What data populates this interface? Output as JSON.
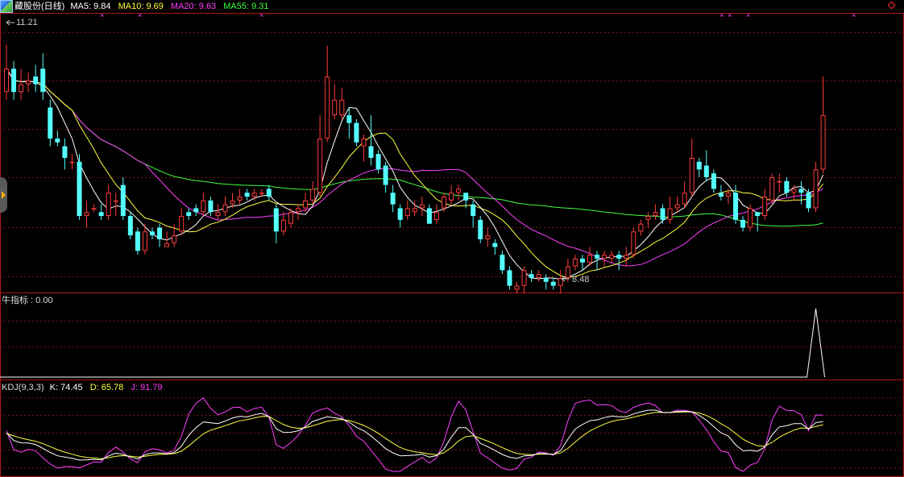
{
  "header": {
    "title": "藏股份(日线)",
    "ma_items": [
      {
        "label": "MA5: 9.84",
        "color": "#ffffff"
      },
      {
        "label": "MA10: 9.69",
        "color": "#ffff40"
      },
      {
        "label": "MA20: 9.63",
        "color": "#ff40ff"
      },
      {
        "label": "MA55: 9.31",
        "color": "#40ff40"
      }
    ]
  },
  "price_panel": {
    "high_label": "11.21",
    "low_label": "8.48",
    "ylim": [
      8.2,
      11.6
    ]
  },
  "indicator_panel": {
    "label": "牛指标 : 0.00"
  },
  "kdj_panel": {
    "label": "KDJ(9,3,3)",
    "values": [
      {
        "label": "K: 74.45",
        "color": "#ffffff"
      },
      {
        "label": "D: 65.78",
        "color": "#ffff40"
      },
      {
        "label": "J: 91.79",
        "color": "#ff40ff"
      }
    ]
  },
  "colors": {
    "up": "#ff3c3c",
    "down": "#54ffff",
    "grid": "#7a1010",
    "border": "#b01818",
    "ma5": "#ffffff",
    "ma10": "#ffff40",
    "ma20": "#ff40ff",
    "ma55": "#40ff40",
    "marker": "#ff40ff"
  },
  "chart_data": {
    "type": "candlestick",
    "candles": [
      [
        10.6,
        10.9,
        11.21,
        10.5
      ],
      [
        10.9,
        10.6,
        11.0,
        10.5
      ],
      [
        10.6,
        10.7,
        10.9,
        10.5
      ],
      [
        10.7,
        10.75,
        10.85,
        10.6
      ],
      [
        10.8,
        10.7,
        10.95,
        10.6
      ],
      [
        10.9,
        10.6,
        11.1,
        10.5
      ],
      [
        10.4,
        10.0,
        10.5,
        9.9
      ],
      [
        10.0,
        9.95,
        10.1,
        9.9
      ],
      [
        9.9,
        9.75,
        10.0,
        9.6
      ],
      [
        9.7,
        9.7,
        9.8,
        9.6
      ],
      [
        9.7,
        9.0,
        9.8,
        8.95
      ],
      [
        9.0,
        9.05,
        9.2,
        8.85
      ],
      [
        9.1,
        9.1,
        9.15,
        9.05
      ],
      [
        9.05,
        9.0,
        9.15,
        8.95
      ],
      [
        9.0,
        9.3,
        9.4,
        8.95
      ],
      [
        9.2,
        9.2,
        9.3,
        9.0
      ],
      [
        9.4,
        9.0,
        9.5,
        8.95
      ],
      [
        9.0,
        8.75,
        9.05,
        8.7
      ],
      [
        8.8,
        8.55,
        8.85,
        8.5
      ],
      [
        8.55,
        8.8,
        8.9,
        8.5
      ],
      [
        8.8,
        8.75,
        8.85,
        8.7
      ],
      [
        8.85,
        8.7,
        8.9,
        8.6
      ],
      [
        8.6,
        8.65,
        8.8,
        8.6
      ],
      [
        8.65,
        8.75,
        8.9,
        8.6
      ],
      [
        8.8,
        9.0,
        9.1,
        8.75
      ],
      [
        9.05,
        9.0,
        9.1,
        8.95
      ],
      [
        9.1,
        9.05,
        9.15,
        9.0
      ],
      [
        9.05,
        9.2,
        9.3,
        9.0
      ],
      [
        9.2,
        9.05,
        9.25,
        9.0
      ],
      [
        9.0,
        9.05,
        9.15,
        8.95
      ],
      [
        9.05,
        9.15,
        9.25,
        9.0
      ],
      [
        9.15,
        9.2,
        9.3,
        9.1
      ],
      [
        9.2,
        9.25,
        9.35,
        9.15
      ],
      [
        9.3,
        9.25,
        9.35,
        9.2
      ],
      [
        9.25,
        9.3,
        9.35,
        9.2
      ],
      [
        9.3,
        9.3,
        9.35,
        9.25
      ],
      [
        9.35,
        9.25,
        9.4,
        9.2
      ],
      [
        9.1,
        8.8,
        9.15,
        8.65
      ],
      [
        8.8,
        8.95,
        9.05,
        8.75
      ],
      [
        8.9,
        9.05,
        9.1,
        8.85
      ],
      [
        9.05,
        9.1,
        9.15,
        8.95
      ],
      [
        9.1,
        9.2,
        9.3,
        9.05
      ],
      [
        9.2,
        9.35,
        9.45,
        9.15
      ],
      [
        9.3,
        10.0,
        10.3,
        9.25
      ],
      [
        10.0,
        10.8,
        11.2,
        9.95
      ],
      [
        10.3,
        10.5,
        10.7,
        10.25
      ],
      [
        10.3,
        10.5,
        10.65,
        10.25
      ],
      [
        10.3,
        10.2,
        10.4,
        10.0
      ],
      [
        10.2,
        9.95,
        10.25,
        9.9
      ],
      [
        9.9,
        10.0,
        10.05,
        9.7
      ],
      [
        9.9,
        9.75,
        10.3,
        9.65
      ],
      [
        9.8,
        9.6,
        9.85,
        9.55
      ],
      [
        9.65,
        9.4,
        9.7,
        9.3
      ],
      [
        9.3,
        9.15,
        9.4,
        9.05
      ],
      [
        9.1,
        8.95,
        9.15,
        8.85
      ],
      [
        9.0,
        9.1,
        9.2,
        8.95
      ],
      [
        9.05,
        9.1,
        9.2,
        9.0
      ],
      [
        9.1,
        9.15,
        9.25,
        9.0
      ],
      [
        9.1,
        8.9,
        9.15,
        8.9
      ],
      [
        8.95,
        9.05,
        9.15,
        8.9
      ],
      [
        9.1,
        9.25,
        9.3,
        9.05
      ],
      [
        9.2,
        9.3,
        9.4,
        9.15
      ],
      [
        9.3,
        9.35,
        9.4,
        9.2
      ],
      [
        9.3,
        9.2,
        9.3,
        9.1
      ],
      [
        9.15,
        9.0,
        9.2,
        8.85
      ],
      [
        8.95,
        8.7,
        9.0,
        8.65
      ],
      [
        8.7,
        8.75,
        8.85,
        8.6
      ],
      [
        8.65,
        8.6,
        8.7,
        8.5
      ],
      [
        8.5,
        8.3,
        8.55,
        8.25
      ],
      [
        8.3,
        8.1,
        8.35,
        8.05
      ],
      [
        8.05,
        8.1,
        8.15,
        8.0
      ],
      [
        8.1,
        8.3,
        8.35,
        8.0
      ],
      [
        8.25,
        8.2,
        8.3,
        8.15
      ],
      [
        8.2,
        8.25,
        8.3,
        8.15
      ],
      [
        8.2,
        8.15,
        8.25,
        8.05
      ],
      [
        8.15,
        8.1,
        8.2,
        8.05
      ],
      [
        8.1,
        8.2,
        8.3,
        8.0
      ],
      [
        8.2,
        8.35,
        8.45,
        8.15
      ],
      [
        8.35,
        8.45,
        8.5,
        8.3
      ],
      [
        8.45,
        8.4,
        8.5,
        8.3
      ],
      [
        8.4,
        8.5,
        8.6,
        8.35
      ],
      [
        8.5,
        8.45,
        8.55,
        8.3
      ],
      [
        8.45,
        8.5,
        8.55,
        8.35
      ],
      [
        8.45,
        8.5,
        8.55,
        8.4
      ],
      [
        8.5,
        8.45,
        8.55,
        8.3
      ],
      [
        8.45,
        8.5,
        8.6,
        8.35
      ],
      [
        8.5,
        8.8,
        8.85,
        8.45
      ],
      [
        8.8,
        8.9,
        8.95,
        8.75
      ],
      [
        8.95,
        9.0,
        9.05,
        8.85
      ],
      [
        9.0,
        9.05,
        9.15,
        8.95
      ],
      [
        9.1,
        8.95,
        9.15,
        8.9
      ],
      [
        8.95,
        9.1,
        9.25,
        8.9
      ],
      [
        9.1,
        9.15,
        9.25,
        9.05
      ],
      [
        9.15,
        9.3,
        9.45,
        9.1
      ],
      [
        9.3,
        9.75,
        10.0,
        9.25
      ],
      [
        9.7,
        9.6,
        9.75,
        9.5
      ],
      [
        9.65,
        9.5,
        9.85,
        9.45
      ],
      [
        9.55,
        9.35,
        9.6,
        9.3
      ],
      [
        9.3,
        9.25,
        9.4,
        9.2
      ],
      [
        9.25,
        9.3,
        9.35,
        9.15
      ],
      [
        9.3,
        8.95,
        9.4,
        8.9
      ],
      [
        8.95,
        8.85,
        9.0,
        8.8
      ],
      [
        8.85,
        9.1,
        9.15,
        8.8
      ],
      [
        9.05,
        9.0,
        9.05,
        8.8
      ],
      [
        9.0,
        9.25,
        9.35,
        8.95
      ],
      [
        9.2,
        9.5,
        9.55,
        9.15
      ],
      [
        9.45,
        9.45,
        9.55,
        9.3
      ],
      [
        9.45,
        9.3,
        9.5,
        9.25
      ],
      [
        9.3,
        9.35,
        9.4,
        9.2
      ],
      [
        9.35,
        9.3,
        9.45,
        9.15
      ],
      [
        9.3,
        9.1,
        9.35,
        9.05
      ],
      [
        9.1,
        9.6,
        9.7,
        9.05
      ],
      [
        9.6,
        10.3,
        10.8,
        9.55
      ]
    ]
  }
}
